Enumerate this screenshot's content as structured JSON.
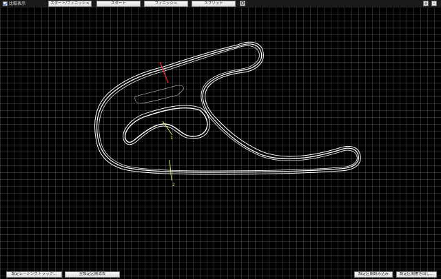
{
  "toolbar": {
    "compare_label": "比較表示",
    "start_finish_label": "スタート/フィニッシュ",
    "start_label": "スタート",
    "finish_label": "フィニッシュ",
    "split_label": "スプリット",
    "settings_icon": "gear-icon",
    "zoom_in_label": "+",
    "zoom_out_label": "-"
  },
  "track_map": {
    "split_markers": [
      "1",
      "2"
    ],
    "colors": {
      "track": "#ffffff",
      "start_line": "#ff2a2a",
      "split_line": "#e8e860",
      "background": "#000000",
      "grid": "#3a3a3a"
    }
  },
  "bottom_bar": {
    "racing_track_label": "設定レーシングトラック...",
    "all_sections_label": "全設定区間消去",
    "load_sections_label": "設定区間読み込み",
    "save_sections_label": "設定区間書き出し..."
  }
}
